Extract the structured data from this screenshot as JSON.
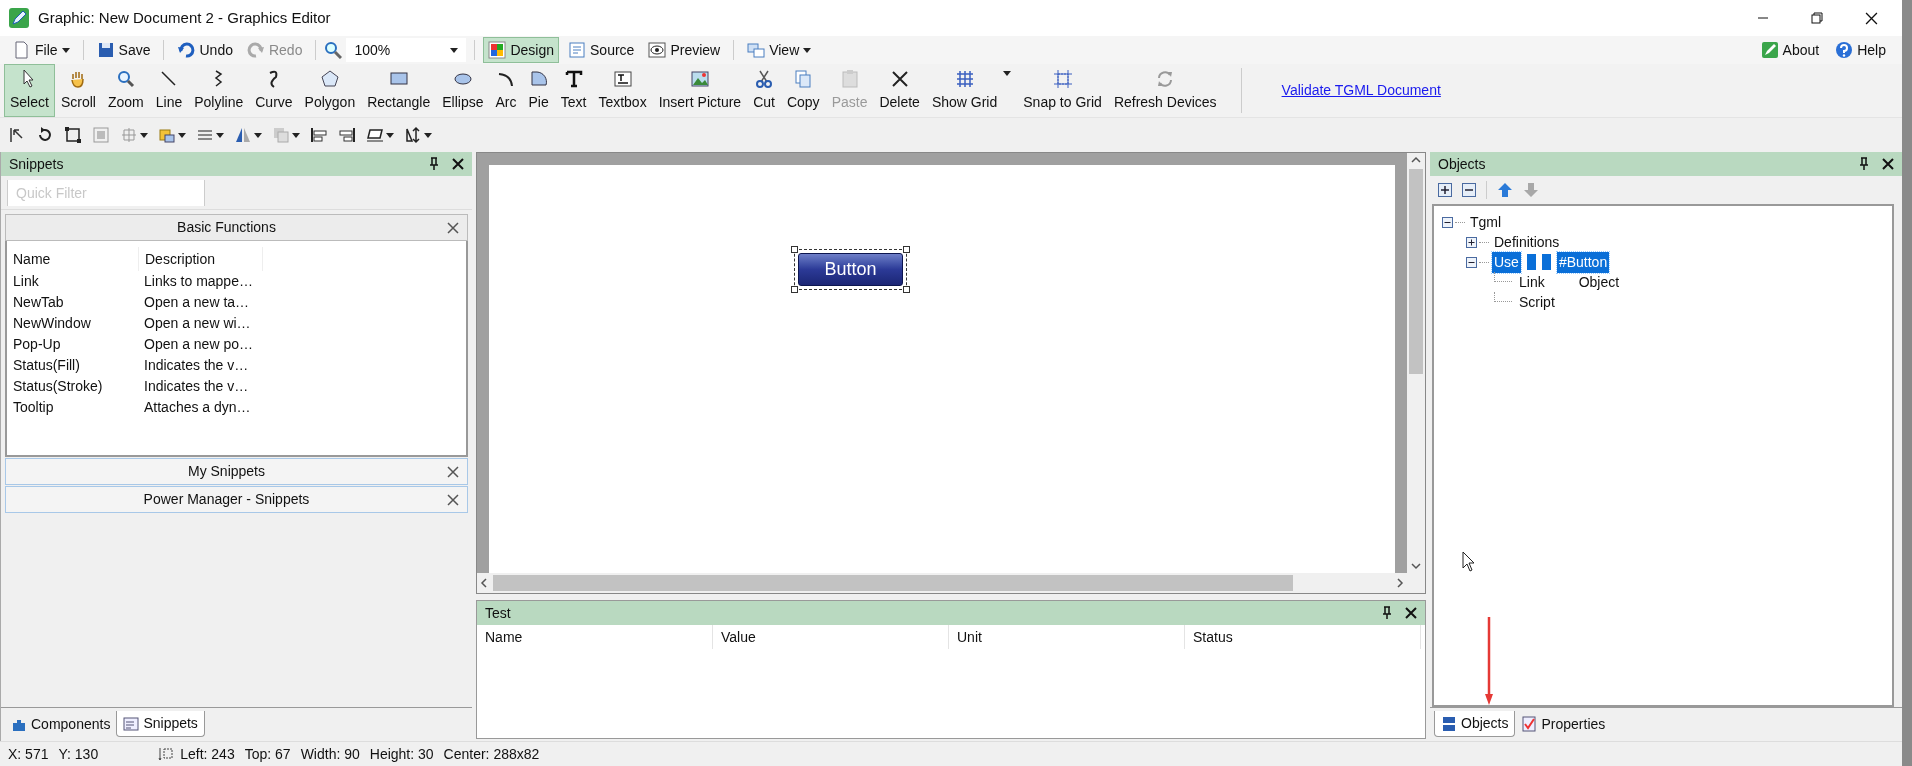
{
  "window": {
    "title": "Graphic: New Document 2 - Graphics Editor"
  },
  "menu_bar": {
    "items": [
      {
        "kind": "button",
        "label": "File",
        "dropdown": true,
        "disabled": false,
        "selected": false
      },
      {
        "kind": "button",
        "label": "Save",
        "dropdown": false,
        "disabled": false,
        "selected": false
      },
      {
        "kind": "button",
        "label": "Undo",
        "dropdown": false,
        "disabled": false,
        "selected": false
      },
      {
        "kind": "button",
        "label": "Redo",
        "dropdown": false,
        "disabled": true,
        "selected": false
      },
      {
        "kind": "combo",
        "value": "100%"
      },
      {
        "kind": "button",
        "label": "Design",
        "dropdown": false,
        "disabled": false,
        "selected": true
      },
      {
        "kind": "button",
        "label": "Source",
        "dropdown": false,
        "disabled": false,
        "selected": false
      },
      {
        "kind": "button",
        "label": "Preview",
        "dropdown": false,
        "disabled": false,
        "selected": false
      },
      {
        "kind": "button",
        "label": "View",
        "dropdown": true,
        "disabled": false,
        "selected": false
      }
    ],
    "right_items": [
      {
        "label": "About"
      },
      {
        "label": "Help"
      }
    ]
  },
  "ribbon": {
    "tools": [
      {
        "label": "Select",
        "selected": true,
        "disabled": false,
        "dropdown": false
      },
      {
        "label": "Scroll",
        "selected": false,
        "disabled": false,
        "dropdown": false
      },
      {
        "label": "Zoom",
        "selected": false,
        "disabled": false,
        "dropdown": false
      },
      {
        "label": "Line",
        "selected": false,
        "disabled": false,
        "dropdown": false
      },
      {
        "label": "Polyline",
        "selected": false,
        "disabled": false,
        "dropdown": false
      },
      {
        "label": "Curve",
        "selected": false,
        "disabled": false,
        "dropdown": false
      },
      {
        "label": "Polygon",
        "selected": false,
        "disabled": false,
        "dropdown": false
      },
      {
        "label": "Rectangle",
        "selected": false,
        "disabled": false,
        "dropdown": false
      },
      {
        "label": "Ellipse",
        "selected": false,
        "disabled": false,
        "dropdown": false
      },
      {
        "label": "Arc",
        "selected": false,
        "disabled": false,
        "dropdown": false
      },
      {
        "label": "Pie",
        "selected": false,
        "disabled": false,
        "dropdown": false
      },
      {
        "label": "Text",
        "selected": false,
        "disabled": false,
        "dropdown": false
      },
      {
        "label": "Textbox",
        "selected": false,
        "disabled": false,
        "dropdown": false
      },
      {
        "label": "Insert Picture",
        "selected": false,
        "disabled": false,
        "dropdown": false
      },
      {
        "label": "Cut",
        "selected": false,
        "disabled": false,
        "dropdown": false
      },
      {
        "label": "Copy",
        "selected": false,
        "disabled": false,
        "dropdown": false
      },
      {
        "label": "Paste",
        "selected": false,
        "disabled": true,
        "dropdown": false
      },
      {
        "label": "Delete",
        "selected": false,
        "disabled": false,
        "dropdown": false
      },
      {
        "label": "Show Grid",
        "selected": false,
        "disabled": false,
        "dropdown": true
      },
      {
        "label": "Snap to Grid",
        "selected": false,
        "disabled": false,
        "dropdown": false
      },
      {
        "label": "Refresh Devices",
        "selected": false,
        "disabled": false,
        "dropdown": false
      }
    ],
    "link": "Validate TGML Document"
  },
  "snippets_panel": {
    "title": "Snippets",
    "filter": {
      "placeholder": "Quick Filter"
    },
    "groups": [
      {
        "title": "Basic Functions",
        "expanded": true,
        "columns": [
          "Name",
          "Description"
        ],
        "rows": [
          {
            "name": "Link",
            "description": "Links to mappe…"
          },
          {
            "name": "NewTab",
            "description": "Open a new ta…"
          },
          {
            "name": "NewWindow",
            "description": "Open a new wi…"
          },
          {
            "name": "Pop-Up",
            "description": "Open a new po…"
          },
          {
            "name": "Status(Fill)",
            "description": "Indicates the v…"
          },
          {
            "name": "Status(Stroke)",
            "description": "Indicates the v…"
          },
          {
            "name": "Tooltip",
            "description": "Attaches a dyn…"
          }
        ]
      },
      {
        "title": "My Snippets",
        "expanded": false
      },
      {
        "title": "Power Manager - Snippets",
        "expanded": false
      }
    ],
    "tabs": [
      {
        "label": "Components",
        "selected": false
      },
      {
        "label": "Snippets",
        "selected": true
      }
    ]
  },
  "canvas": {
    "element": {
      "label": "Button",
      "selected": true
    }
  },
  "test_panel": {
    "title": "Test",
    "columns": [
      "Name",
      "Value",
      "Unit",
      "Status"
    ]
  },
  "objects_panel": {
    "title": "Objects",
    "tree": [
      {
        "label": "Tgml",
        "selected": false,
        "expanded": true,
        "children": [
          {
            "label": "Definitions",
            "selected": false,
            "expanded": false
          },
          {
            "label": "Use",
            "value": "#Button",
            "selected": true,
            "expanded": true,
            "children": [
              {
                "label": "Link",
                "value": "Object",
                "selected": false
              },
              {
                "label": "Script",
                "selected": false
              }
            ]
          }
        ]
      }
    ],
    "tabs": [
      {
        "label": "Objects",
        "selected": true
      },
      {
        "label": "Properties",
        "selected": false
      }
    ]
  },
  "status_bar": {
    "pointer": [
      "X: 571",
      "Y: 130"
    ],
    "selection": [
      "Left: 243",
      "Top: 67",
      "Width: 90",
      "Height: 30",
      "Center: 288x82"
    ]
  }
}
